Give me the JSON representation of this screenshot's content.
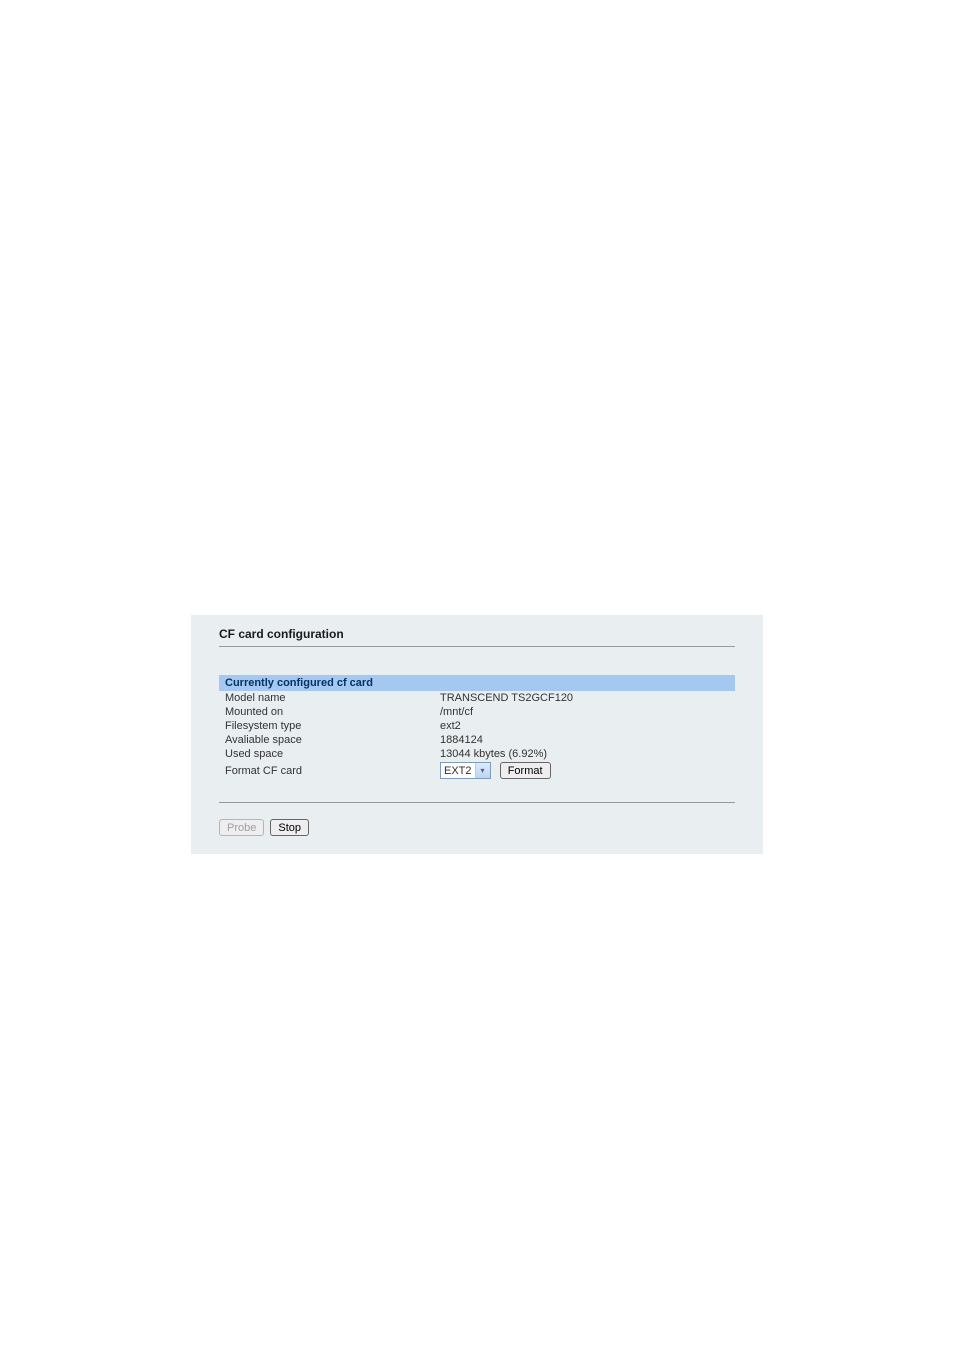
{
  "page": {
    "title": "CF card configuration"
  },
  "section": {
    "header": "Currently configured cf card"
  },
  "rows": {
    "model_name": {
      "label": "Model name",
      "value": "TRANSCEND TS2GCF120"
    },
    "mounted_on": {
      "label": "Mounted on",
      "value": "/mnt/cf"
    },
    "filesystem_type": {
      "label": "Filesystem type",
      "value": "ext2"
    },
    "available_space": {
      "label": "Avaliable space",
      "value": "1884124"
    },
    "used_space": {
      "label": "Used space",
      "value": "13044 kbytes (6.92%)"
    },
    "format": {
      "label": "Format CF card",
      "selected": "EXT2",
      "button_label": "Format"
    }
  },
  "buttons": {
    "probe": "Probe",
    "stop": "Stop"
  }
}
